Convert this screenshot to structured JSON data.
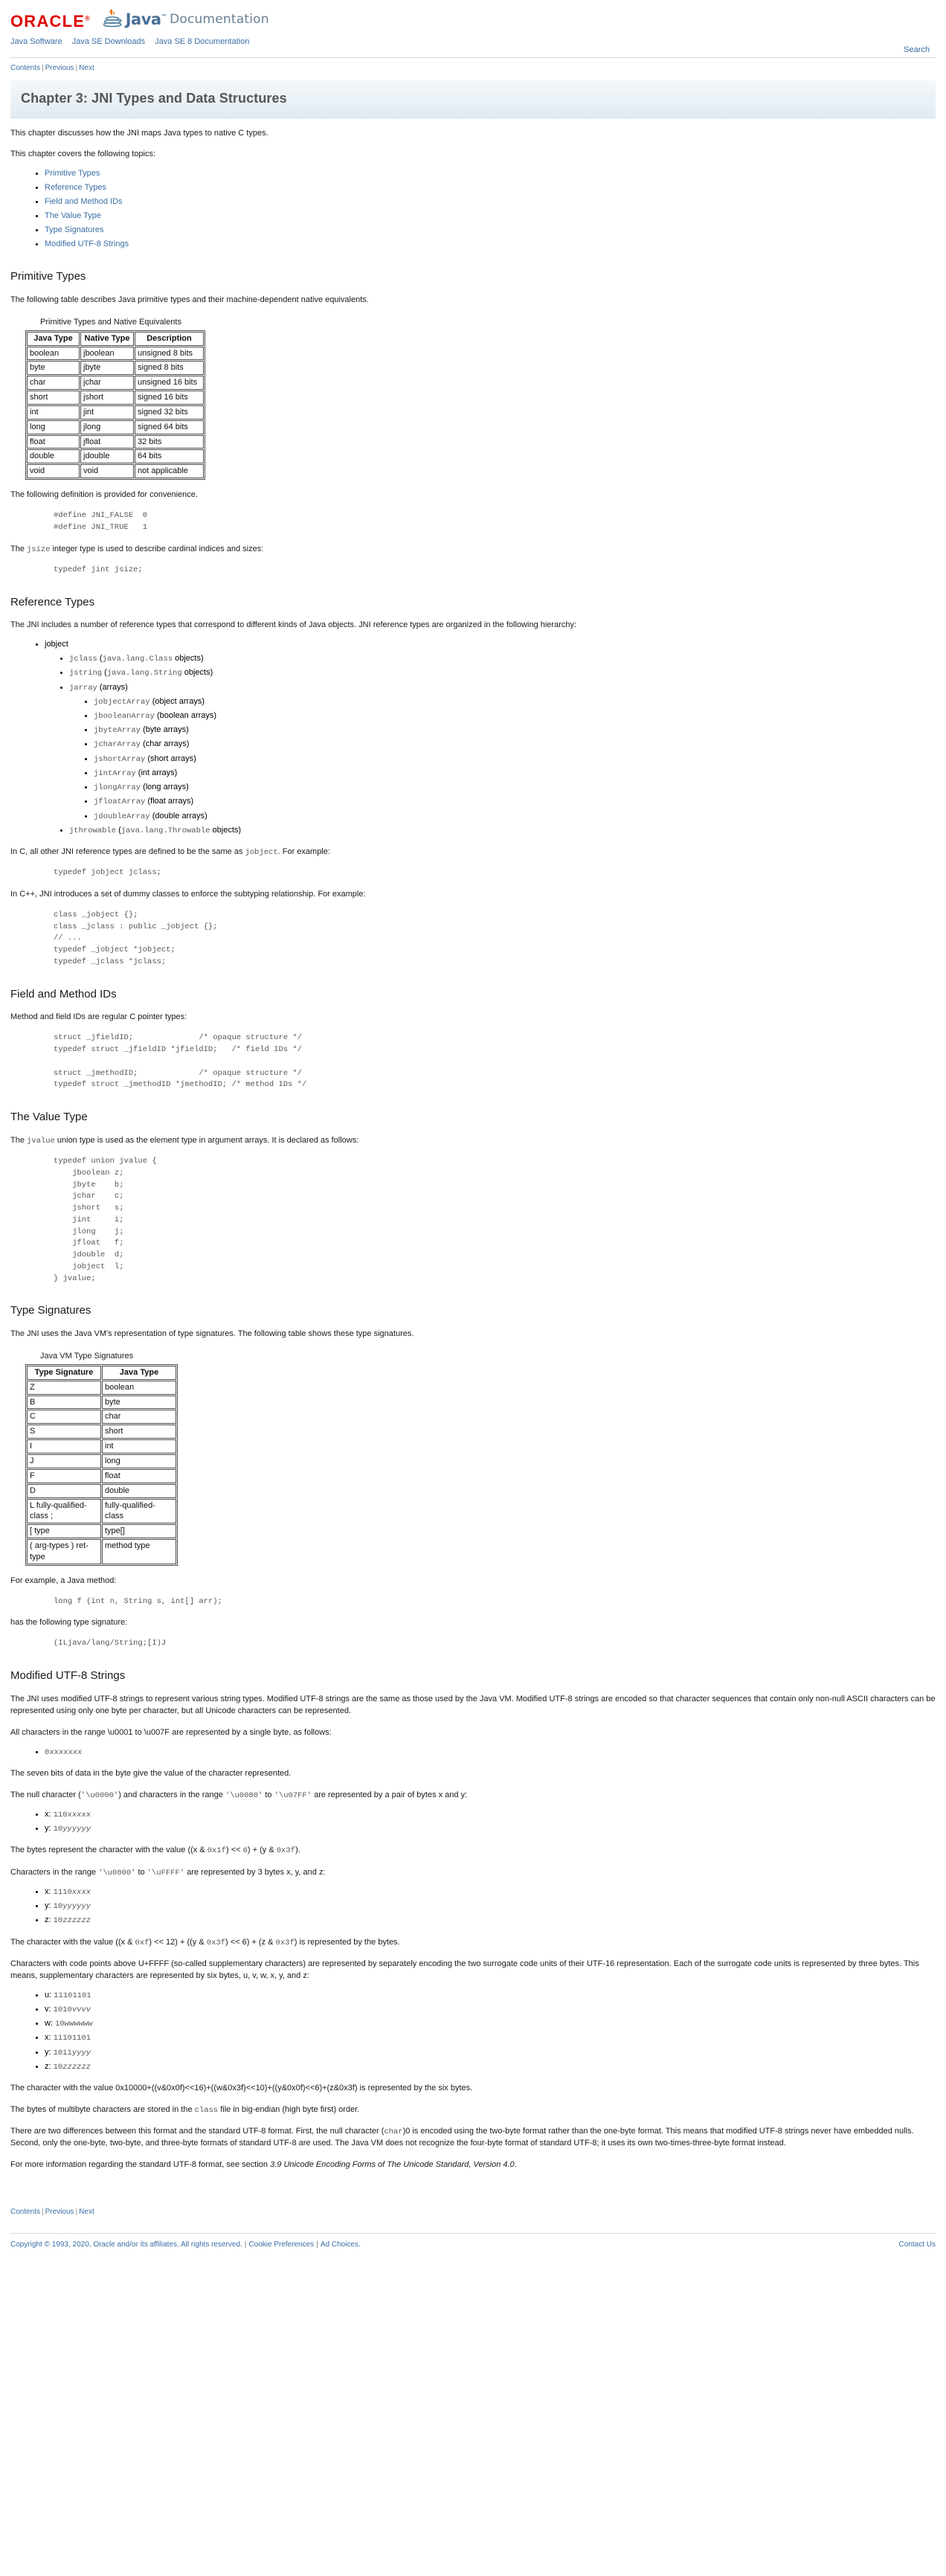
{
  "header": {
    "oracle_logo_text": "ORACLE",
    "oracle_tm": "®",
    "java_word": "Java",
    "java_tm": "™",
    "documentation_word": "Documentation",
    "search_label": "Search"
  },
  "nav": {
    "items": [
      {
        "label": "Java Software"
      },
      {
        "label": "Java SE Downloads"
      },
      {
        "label": "Java SE 8 Documentation"
      }
    ]
  },
  "crumbnav": {
    "contents": "Contents",
    "previous": "Previous",
    "next": "Next",
    "separator": "|"
  },
  "page_title": "Chapter 3: JNI Types and Data Structures",
  "intro": {
    "para1": "This chapter discusses how the JNI maps Java types to native C types.",
    "para2": "This chapter covers the following topics:",
    "topics": [
      {
        "label": "Primitive Types"
      },
      {
        "label": "Reference Types"
      },
      {
        "label": "Field and Method IDs"
      },
      {
        "label": "The Value Type"
      },
      {
        "label": "Type Signatures"
      },
      {
        "label": "Modified UTF-8 Strings"
      }
    ]
  },
  "primitive_types": {
    "heading": "Primitive Types",
    "intro": "The following table describes Java primitive types and their machine-dependent native equivalents.",
    "table_caption": "Primitive Types and Native Equivalents",
    "columns": [
      "Java Type",
      "Native Type",
      "Description"
    ],
    "rows": [
      [
        "boolean",
        "jboolean",
        "unsigned 8 bits"
      ],
      [
        "byte",
        "jbyte",
        "signed 8 bits"
      ],
      [
        "char",
        "jchar",
        "unsigned 16 bits"
      ],
      [
        "short",
        "jshort",
        "signed 16 bits"
      ],
      [
        "int",
        "jint",
        "signed 32 bits"
      ],
      [
        "long",
        "jlong",
        "signed 64 bits"
      ],
      [
        "float",
        "jfloat",
        "32 bits"
      ],
      [
        "double",
        "jdouble",
        "64 bits"
      ],
      [
        "void",
        "void",
        "not applicable"
      ]
    ],
    "definition_intro": "The following definition is provided for convenience.",
    "definition_code": "#define JNI_FALSE  0\n#define JNI_TRUE   1",
    "jsize_intro_pre": "The ",
    "jsize_code": "jsize",
    "jsize_intro_post": " integer type is used to describe cardinal indices and sizes:",
    "jsize_code_block": "typedef jint jsize;"
  },
  "reference_types": {
    "heading": "Reference Types",
    "intro": "The JNI includes a number of reference types that correspond to different kinds of Java objects. JNI reference types are organized in the following hierarchy:",
    "hierarchy": {
      "root": "jobject",
      "level2": [
        {
          "code": "jclass",
          "note": "(java.lang.Class objects)",
          "note_code": "java.lang.Class",
          "note_pre": "(",
          "note_post": " objects)"
        },
        {
          "code": "jstring",
          "note_code": "java.lang.String",
          "note_pre": "(",
          "note_post": " objects)"
        },
        {
          "code": "jarray",
          "plain": "(arrays)"
        },
        {
          "code": "jthrowable",
          "note_code": "java.lang.Throwable",
          "note_pre": "(",
          "note_post": " objects)"
        }
      ],
      "array_children": [
        {
          "code": "jobjectArray",
          "plain": "(object arrays)"
        },
        {
          "code": "jbooleanArray",
          "plain": "(boolean arrays)"
        },
        {
          "code": "jbyteArray",
          "plain": "(byte arrays)"
        },
        {
          "code": "jcharArray",
          "plain": "(char arrays)"
        },
        {
          "code": "jshortArray",
          "plain": "(short arrays)"
        },
        {
          "code": "jintArray",
          "plain": "(int arrays)"
        },
        {
          "code": "jlongArray",
          "plain": "(long arrays)"
        },
        {
          "code": "jfloatArray",
          "plain": "(float arrays)"
        },
        {
          "code": "jdoubleArray",
          "plain": "(double arrays)"
        }
      ]
    },
    "c_note_pre": "In C, all other JNI reference types are defined to be the same as ",
    "c_note_code": "jobject",
    "c_note_post": ". For example:",
    "c_code": "typedef jobject jclass;",
    "cpp_note": "In C++, JNI introduces a set of dummy classes to enforce the subtyping relationship. For example:",
    "cpp_code": "class _jobject {};\nclass _jclass : public _jobject {};\n// ...\ntypedef _jobject *jobject;\ntypedef _jclass *jclass;"
  },
  "field_method_ids": {
    "heading": "Field and Method IDs",
    "intro": "Method and field IDs are regular C pointer types:",
    "code": "struct _jfieldID;              /* opaque structure */\ntypedef struct _jfieldID *jfieldID;   /* field IDs */\n\nstruct _jmethodID;             /* opaque structure */\ntypedef struct _jmethodID *jmethodID; /* method IDs */"
  },
  "value_type": {
    "heading": "The Value Type",
    "intro_pre": "The ",
    "intro_code": "jvalue",
    "intro_post": " union type is used as the element type in argument arrays. It is declared as follows:",
    "code": "typedef union jvalue {\n    jboolean z;\n    jbyte    b;\n    jchar    c;\n    jshort   s;\n    jint     i;\n    jlong    j;\n    jfloat   f;\n    jdouble  d;\n    jobject  l;\n} jvalue;"
  },
  "type_signatures": {
    "heading": "Type Signatures",
    "intro": "The JNI uses the Java VM's representation of type signatures. The following table shows these type signatures.",
    "table_caption": "Java VM Type Signatures",
    "columns": [
      "Type Signature",
      "Java Type"
    ],
    "rows": [
      [
        "Z",
        "boolean"
      ],
      [
        "B",
        "byte"
      ],
      [
        "C",
        "char"
      ],
      [
        "S",
        "short"
      ],
      [
        "I",
        "int"
      ],
      [
        "J",
        "long"
      ],
      [
        "F",
        "float"
      ],
      [
        "D",
        "double"
      ],
      [
        "L fully-qualified-class ;",
        "fully-qualified-class"
      ],
      [
        "[ type",
        "type[]"
      ],
      [
        "( arg-types ) ret-type",
        "method type"
      ]
    ],
    "example_intro": "For example, a Java method:",
    "example_code": "long f (int n, String s, int[] arr);",
    "sig_intro": "has the following type signature:",
    "sig_code": "(ILjava/lang/String;[I)J"
  },
  "utf8": {
    "heading": "Modified UTF-8 Strings",
    "para1": "The JNI uses modified UTF-8 strings to represent various string types. Modified UTF-8 strings are the same as those used by the Java VM. Modified UTF-8 strings are encoded so that character sequences that contain only non-null ASCII characters can be represented using only one byte per character, but all Unicode characters can be represented.",
    "para2": "All characters in the range \\u0001 to \\u007F are represented by a single byte, as follows:",
    "single_byte": {
      "prefix": "0",
      "xs": "xxxxxxx"
    },
    "para3": "The seven bits of data in the byte give the value of the character represented.",
    "para4_pre": "The null character (",
    "para4_c1": "'\\u0000'",
    "para4_mid": ") and characters in the range ",
    "para4_c2": "'\\u0080'",
    "para4_mid2": " to ",
    "para4_c3": "'\\u07FF'",
    "para4_post": " are represented by a pair of bytes x and y:",
    "pair_bytes": [
      {
        "label": "x: ",
        "prefix": "110",
        "xs": "xxxxx"
      },
      {
        "label": "y: ",
        "prefix": "10",
        "xs": "yyyyyy"
      }
    ],
    "para5_pre": "The bytes represent the character with the value ((x & ",
    "para5_c1": "0x1f",
    "para5_mid": ") << ",
    "para5_c2": "6",
    "para5_mid2": ") + (y & ",
    "para5_c3": "0x3f",
    "para5_post": ").",
    "para6_pre": "Characters in the range ",
    "para6_c1": "'\\u0800'",
    "para6_mid": " to ",
    "para6_c2": "'\\uFFFF'",
    "para6_post": " are represented by 3 bytes x, y, and z:",
    "triple_bytes": [
      {
        "label": "x: ",
        "prefix": "1110",
        "xs": "xxxx"
      },
      {
        "label": "y: ",
        "prefix": "10",
        "xs": "yyyyyy"
      },
      {
        "label": "z: ",
        "prefix": "10",
        "xs": "zzzzzz"
      }
    ],
    "para7_pre": "The character with the value ((x & ",
    "para7_c1": "0xf",
    "para7_mid": ") << 12) + ((y & ",
    "para7_c2": "0x3f",
    "para7_mid2": ") << 6) + (z & ",
    "para7_c3": "0x3f",
    "para7_post": ") is represented by the bytes.",
    "para8": "Characters with code points above U+FFFF (so-called supplementary characters) are represented by separately encoding the two surrogate code units of their UTF-16 representation. Each of the surrogate code units is represented by three bytes. This means, supplementary characters are represented by six bytes, u, v, w, x, y, and z:",
    "six_bytes": [
      {
        "label": "u: ",
        "prefix": "11101101",
        "xs": ""
      },
      {
        "label": "v: ",
        "prefix": "1010",
        "xs": "vvvv"
      },
      {
        "label": "w: ",
        "prefix": "10",
        "xs": "wwwwww"
      },
      {
        "label": "x: ",
        "prefix": "11101101",
        "xs": ""
      },
      {
        "label": "y: ",
        "prefix": "1011",
        "xs": "yyyy"
      },
      {
        "label": "z: ",
        "prefix": "10",
        "xs": "zzzzzz"
      }
    ],
    "para9": "The character with the value 0x10000+((v&0x0f)<<16)+((w&0x3f)<<10)+((y&0x0f)<<6)+(z&0x3f) is represented by the six bytes.",
    "para10_pre": "The bytes of multibyte characters are stored in the ",
    "para10_code": "class",
    "para10_post": " file in big-endian (high byte first) order.",
    "para11_pre": "There are two differences between this format and the standard UTF-8 format. First, the null character (",
    "para11_code": "char",
    "para11_mid": ")0 is encoded using the two-byte format rather than the one-byte format. This means that modified UTF-8 strings never have embedded nulls. Second, only the one-byte, two-byte, and three-byte formats of standard UTF-8 are used. The Java VM does not recognize the four-byte format of standard UTF-8; it uses its own two-times-three-byte format instead.",
    "para12_pre": "For more information regarding the standard UTF-8 format, see section ",
    "para12_ital": "3.9 Unicode Encoding Forms of The Unicode Standard, Version 4.0",
    "para12_post": "."
  },
  "footer": {
    "nav": {
      "contents": "Contents",
      "previous": "Previous",
      "next": "Next",
      "separator": "|"
    },
    "copyright": "Copyright © 1993, 2020, Oracle and/or its affiliates. All rights reserved.",
    "cookie_prefs": "Cookie Preferences",
    "ad_choices": "Ad Choices.",
    "contact_us": "Contact Us",
    "separator": "|"
  },
  "colors": {
    "link": "#3a6ea5",
    "oracle_red": "#e00000",
    "title_gray": "#555555",
    "banner_bg": "#eaf1f6"
  }
}
